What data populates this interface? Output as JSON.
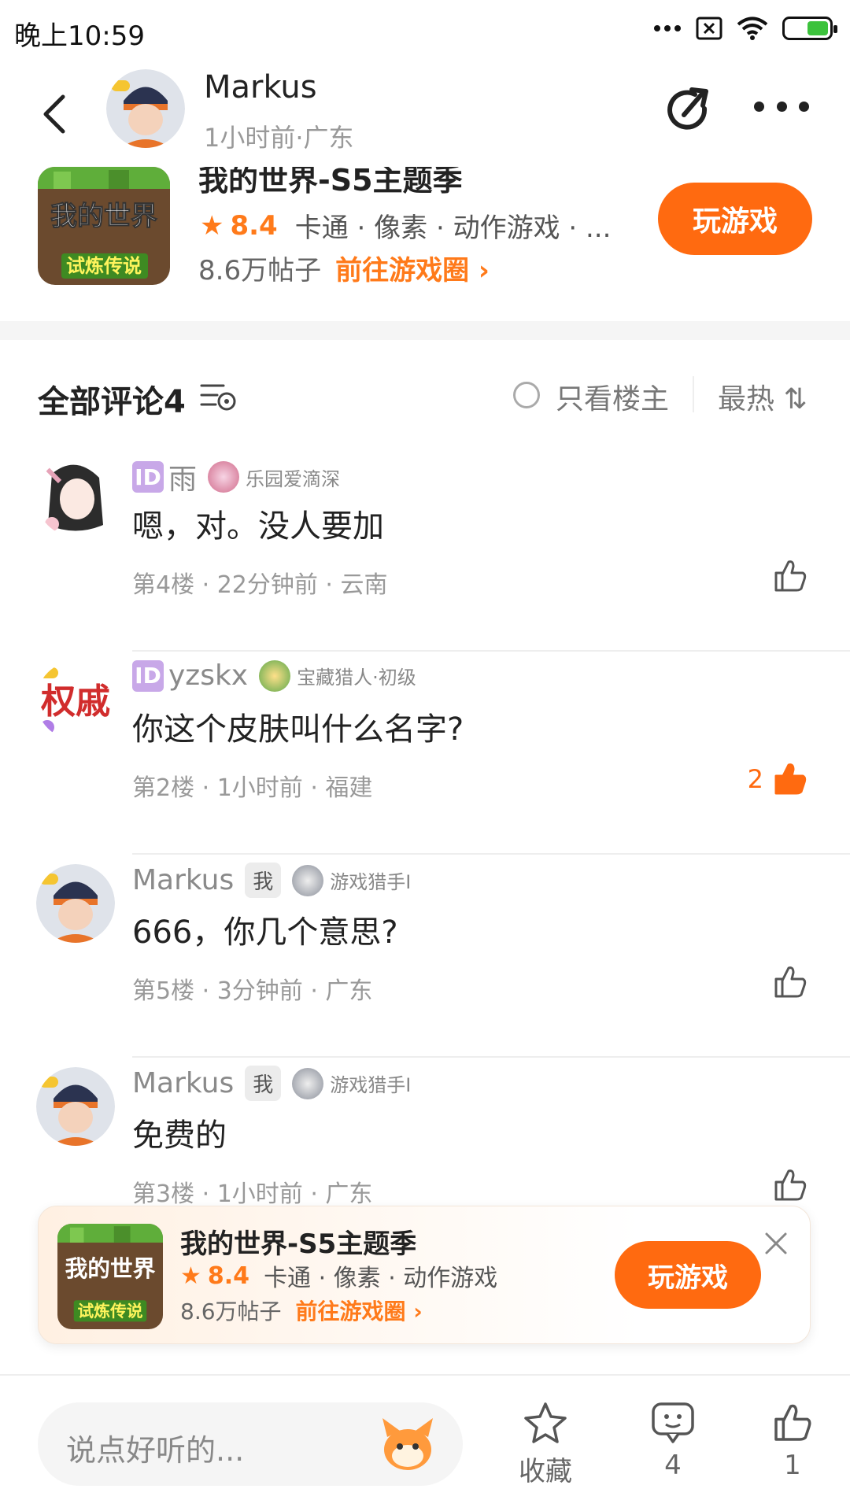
{
  "status_bar": {
    "time": "晚上10:59",
    "icons": [
      "more-dots-icon",
      "sim-off-icon",
      "wifi-icon",
      "battery-charging-icon"
    ]
  },
  "header": {
    "author_name": "Markus",
    "author_meta": "1小时前·广东",
    "icons": [
      "back-icon",
      "share-icon",
      "more-icon"
    ]
  },
  "game_card": {
    "title": "我的世界-S5主题季",
    "icon_text_top": "我的世界",
    "icon_text_bottom": "试炼传说",
    "score": "8.4",
    "tags": "卡通 · 像素 · 动作游戏 · ...",
    "posts": "8.6万帖子",
    "go_circle": "前往游戏圈",
    "play_label": "玩游戏"
  },
  "comments_header": {
    "title": "全部评论4",
    "only_owner": "只看楼主",
    "sort_label": "最热"
  },
  "comments": [
    {
      "id_badge": "ID",
      "name": "雨",
      "title": "乐园爱滴深",
      "content": "嗯，对。没人要加",
      "meta": "第4楼 · 22分钟前 · 云南",
      "likes": "",
      "liked": false
    },
    {
      "id_badge": "ID",
      "name": "yzskx",
      "title": "宝藏猎人·初级",
      "content": "你这个皮肤叫什么名字?",
      "meta": "第2楼 · 1小时前 · 福建",
      "likes": "2",
      "liked": true
    },
    {
      "name": "Markus",
      "me_tag": "我",
      "title": "游戏猎手I",
      "content": "666，你几个意思?",
      "meta": "第5楼 · 3分钟前 · 广东",
      "likes": "",
      "liked": false
    },
    {
      "name": "Markus",
      "me_tag": "我",
      "title": "游戏猎手I",
      "content": "免费的",
      "meta": "第3楼 · 1小时前 · 广东",
      "likes": "",
      "liked": false
    }
  ],
  "float_banner": {
    "title": "我的世界-S5主题季",
    "score": "8.4",
    "tags": "卡通 · 像素 · 动作游戏",
    "posts": "8.6万帖子",
    "go_circle": "前往游戏圈",
    "play_label": "玩游戏"
  },
  "bottom_bar": {
    "input_placeholder": "说点好听的...",
    "favorite_label": "收藏",
    "comment_count": "4",
    "like_count": "1"
  },
  "colors": {
    "accent": "#ff6a10",
    "text_primary": "#222222",
    "text_secondary": "#999999"
  }
}
